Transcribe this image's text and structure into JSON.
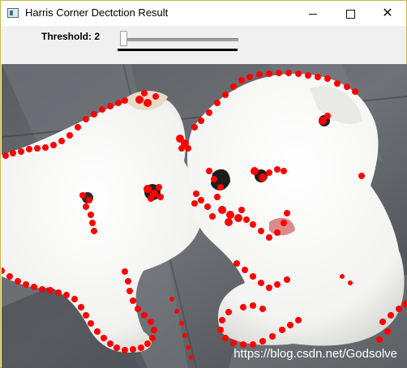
{
  "window": {
    "title": "Harris Corner Dectction Result",
    "controls": {
      "minimize": "minimize-icon",
      "maximize": "maximize-icon",
      "close": "close-icon"
    }
  },
  "trackbar": {
    "label": "Threshold: 2",
    "value": 2
  },
  "image": {
    "subject": "two white puppies on grey stone floor with red Harris corner markers",
    "marker_color": "#ff0000",
    "watermark": "https://blog.csdn.net/Godsolve"
  },
  "colors": {
    "titlebar": "#ffffff",
    "toolbar": "#f0f0f0",
    "floor_dark": "#4c4f54",
    "floor_light": "#8a8d92",
    "fur": "#f6f6f4"
  }
}
